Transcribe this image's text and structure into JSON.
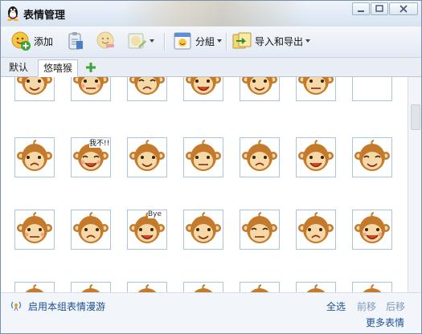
{
  "window": {
    "title": "表情管理"
  },
  "toolbar": {
    "add_label": "添加",
    "group_label": "分組",
    "import_export_label": "导入和导出"
  },
  "tabs": {
    "default_label": "默认",
    "active_label": "悠嘻猴"
  },
  "grid": {
    "rows": [
      {
        "cells": [
          "monkey-face-1",
          "monkey-face-2",
          "monkey-face-3",
          "monkey-face-4",
          "monkey-face-5",
          "monkey-face-6",
          "empty"
        ]
      },
      {
        "cells": [
          "monkey-face-7",
          "monkey-face-8",
          "monkey-face-9",
          "monkey-face-10",
          "monkey-face-11",
          "monkey-face-12",
          "monkey-face-13"
        ]
      },
      {
        "cells": [
          "monkey-face-14",
          "monkey-face-15",
          "monkey-face-16",
          "monkey-face-17",
          "monkey-face-18",
          "monkey-face-19",
          "monkey-face-20"
        ]
      },
      {
        "cells": [
          "monkey-face-21",
          "monkey-face-22",
          "monkey-face-23",
          "monkey-face-24",
          "monkey-face-25",
          "monkey-face-26",
          "monkey-face-27"
        ]
      }
    ],
    "captions": {
      "no_way": "我不!!",
      "bye": "Bye"
    }
  },
  "bottom": {
    "roam_label": "启用本组表情漫游",
    "select_all": "全选",
    "move_prev": "前移",
    "move_next": "后移",
    "more": "更多表情"
  },
  "colors": {
    "monkey": "#c47a2a",
    "face": "#f6d9a8",
    "link": "#1d4f92",
    "cell_border": "#a9c4de"
  }
}
